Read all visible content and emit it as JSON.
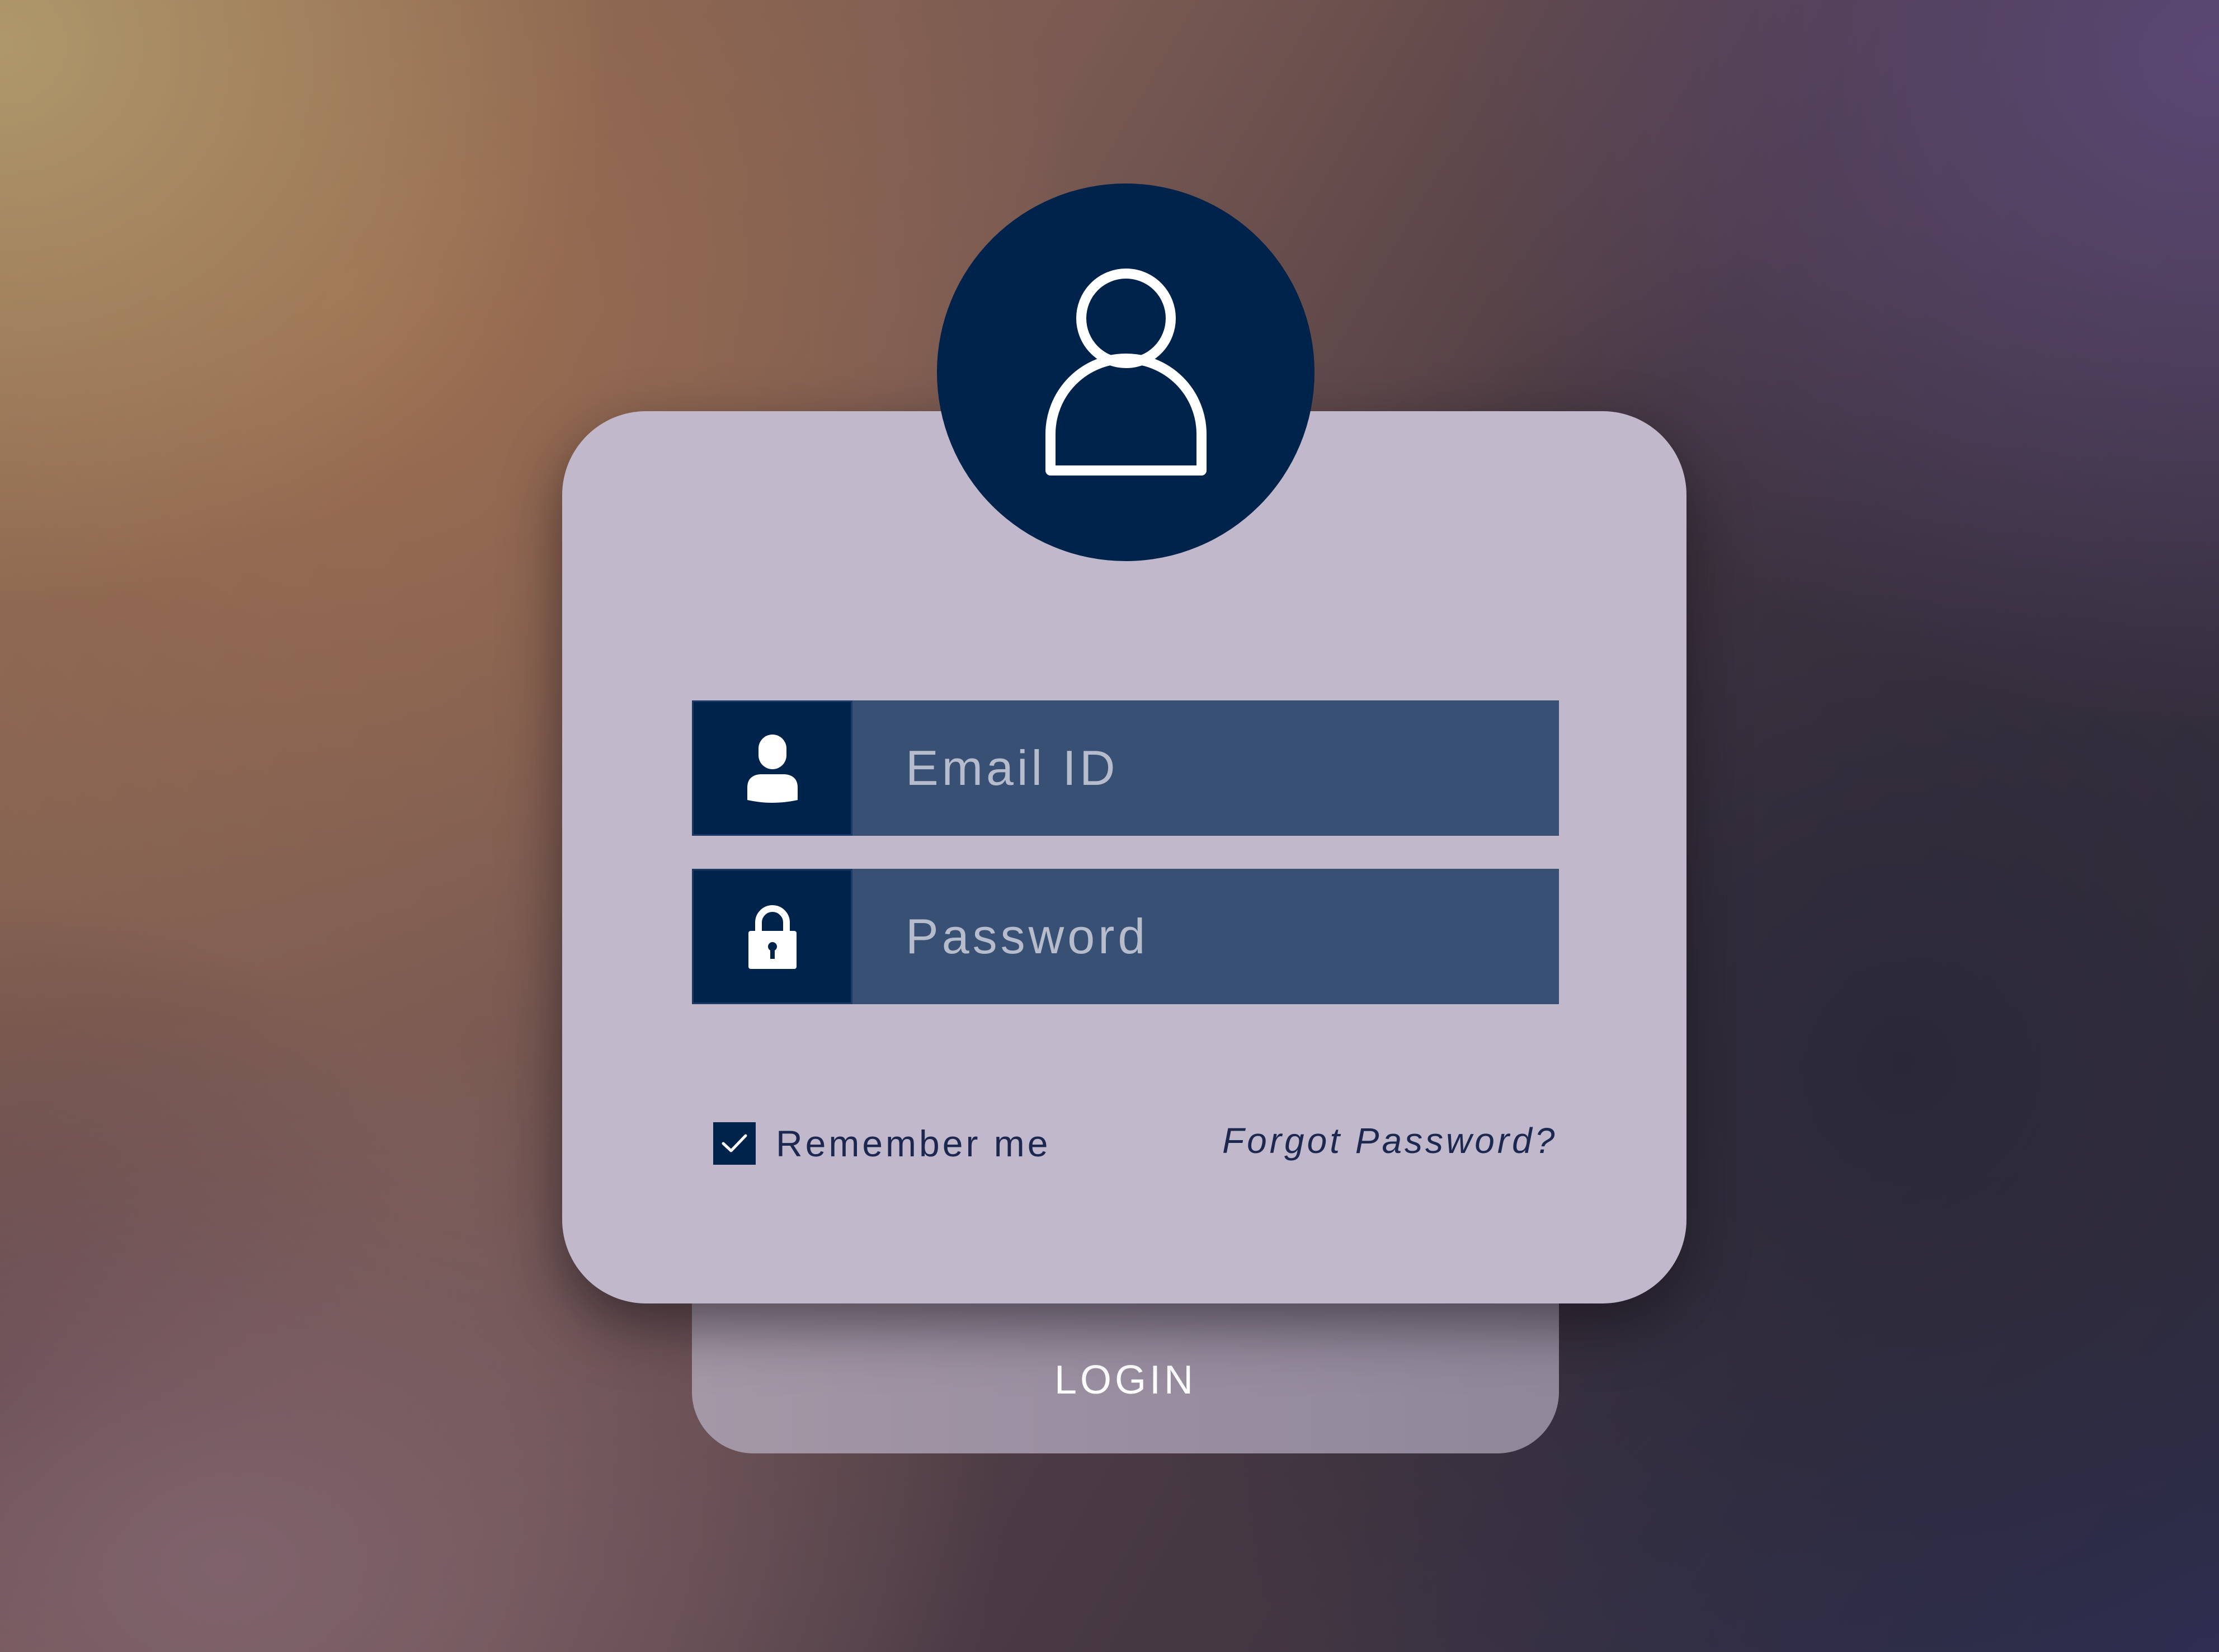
{
  "form": {
    "email": {
      "placeholder": "Email ID",
      "value": "",
      "icon": "user-icon"
    },
    "password": {
      "placeholder": "Password",
      "value": "",
      "icon": "lock-icon"
    },
    "remember": {
      "label": "Remember me",
      "checked": true
    },
    "forgot_label": "Forgot Password?",
    "login_label": "LOGIN"
  },
  "avatar": {
    "icon": "user-outline-icon"
  },
  "colors": {
    "navy": "#00234b",
    "field": "#385073",
    "card": "#c1b8cc",
    "text_dark": "#1c2850"
  }
}
